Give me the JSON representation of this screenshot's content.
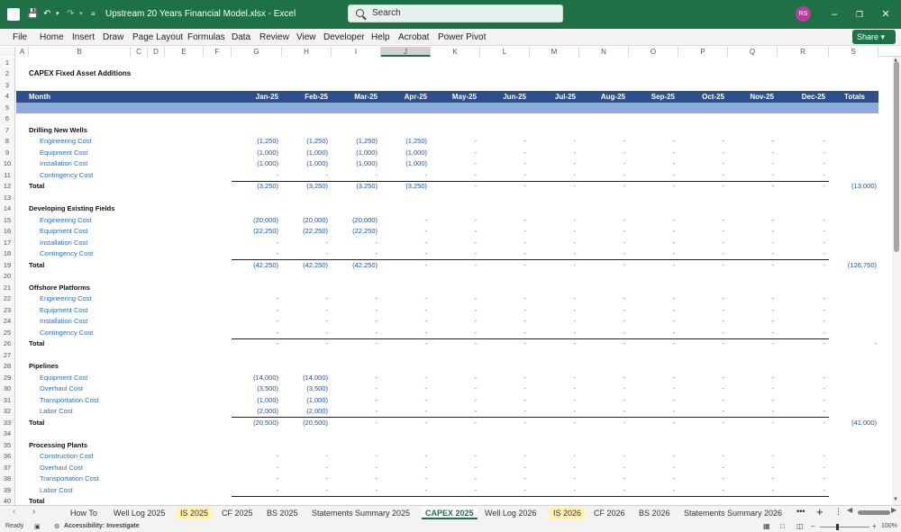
{
  "window": {
    "title": "Upstream 20 Years Financial Model.xlsx - Excel",
    "search_placeholder": "Search",
    "user_initials": "RS"
  },
  "ribbon_tabs": [
    "File",
    "Home",
    "Insert",
    "Draw",
    "Page Layout",
    "Formulas",
    "Data",
    "Review",
    "View",
    "Developer",
    "Help",
    "Acrobat",
    "Power Pivot"
  ],
  "share_label": "Share",
  "columns": [
    "A",
    "B",
    "C",
    "D",
    "E",
    "F",
    "G",
    "H",
    "I",
    "J",
    "K",
    "L",
    "M",
    "N",
    "O",
    "P",
    "Q",
    "R",
    "S"
  ],
  "selected_column": "J",
  "rows": [
    "1",
    "2",
    "3",
    "4",
    "5",
    "6",
    "7",
    "8",
    "9",
    "10",
    "11",
    "12",
    "13",
    "14",
    "15",
    "16",
    "17",
    "18",
    "19",
    "20",
    "21",
    "22",
    "23",
    "24",
    "25",
    "26",
    "27",
    "28",
    "29",
    "30",
    "31",
    "32",
    "33",
    "34",
    "35",
    "36",
    "37",
    "38",
    "39",
    "40"
  ],
  "sheet_title": "CAPEX Fixed Asset Additions",
  "header": {
    "label": "Month",
    "months": [
      "Jan-25",
      "Feb-25",
      "Mar-25",
      "Apr-25",
      "May-25",
      "Jun-25",
      "Jul-25",
      "Aug-25",
      "Sep-25",
      "Oct-25",
      "Nov-25",
      "Dec-25"
    ],
    "totals_label": "Totals"
  },
  "sections": [
    {
      "title": "Drilling New Wells",
      "title_row": 6,
      "items": [
        {
          "row": 7,
          "label": "Engineering Cost",
          "values": [
            "(1,250)",
            "(1,250)",
            "(1,250)",
            "(1,250)",
            "-",
            "-",
            "-",
            "-",
            "-",
            "-",
            "-",
            "-"
          ]
        },
        {
          "row": 8,
          "label": "Equipment Cost",
          "values": [
            "(1,000)",
            "(1,000)",
            "(1,000)",
            "(1,000)",
            "-",
            "-",
            "-",
            "-",
            "-",
            "-",
            "-",
            "-"
          ]
        },
        {
          "row": 9,
          "label": "Installation Cost",
          "values": [
            "(1,000)",
            "(1,000)",
            "(1,000)",
            "(1,000)",
            "-",
            "-",
            "-",
            "-",
            "-",
            "-",
            "-",
            "-"
          ]
        },
        {
          "row": 10,
          "label": "Contingency Cost",
          "values": [
            "-",
            "-",
            "-",
            "-",
            "-",
            "-",
            "-",
            "-",
            "-",
            "-",
            "-",
            "-"
          ]
        }
      ],
      "total": {
        "row": 11,
        "label": "Total",
        "values": [
          "(3,250)",
          "(3,250)",
          "(3,250)",
          "(3,250)",
          "-",
          "-",
          "-",
          "-",
          "-",
          "-",
          "-",
          "-"
        ],
        "sum": "(13,000)"
      }
    },
    {
      "title": "Developing Existing Fields",
      "title_row": 13,
      "items": [
        {
          "row": 14,
          "label": "Engineering Cost",
          "values": [
            "(20,000)",
            "(20,000)",
            "(20,000)",
            "-",
            "-",
            "-",
            "-",
            "-",
            "-",
            "-",
            "-",
            "-"
          ]
        },
        {
          "row": 15,
          "label": "Equipment Cost",
          "values": [
            "(22,250)",
            "(22,250)",
            "(22,250)",
            "-",
            "-",
            "-",
            "-",
            "-",
            "-",
            "-",
            "-",
            "-"
          ]
        },
        {
          "row": 16,
          "label": "Installation Cost",
          "values": [
            "-",
            "-",
            "-",
            "-",
            "-",
            "-",
            "-",
            "-",
            "-",
            "-",
            "-",
            "-"
          ]
        },
        {
          "row": 17,
          "label": "Contingency Cost",
          "values": [
            "-",
            "-",
            "-",
            "-",
            "-",
            "-",
            "-",
            "-",
            "-",
            "-",
            "-",
            "-"
          ]
        }
      ],
      "total": {
        "row": 18,
        "label": "Total",
        "values": [
          "(42,250)",
          "(42,250)",
          "(42,250)",
          "-",
          "-",
          "-",
          "-",
          "-",
          "-",
          "-",
          "-",
          "-"
        ],
        "sum": "(126,750)"
      }
    },
    {
      "title": "Offshore Platforms",
      "title_row": 20,
      "items": [
        {
          "row": 21,
          "label": "Engineering Cost",
          "values": [
            "-",
            "-",
            "-",
            "-",
            "-",
            "-",
            "-",
            "-",
            "-",
            "-",
            "-",
            "-"
          ]
        },
        {
          "row": 22,
          "label": "Equipment Cost",
          "values": [
            "-",
            "-",
            "-",
            "-",
            "-",
            "-",
            "-",
            "-",
            "-",
            "-",
            "-",
            "-"
          ]
        },
        {
          "row": 23,
          "label": "Installation Cost",
          "values": [
            "-",
            "-",
            "-",
            "-",
            "-",
            "-",
            "-",
            "-",
            "-",
            "-",
            "-",
            "-"
          ]
        },
        {
          "row": 24,
          "label": "Contingency Cost",
          "values": [
            "-",
            "-",
            "-",
            "-",
            "-",
            "-",
            "-",
            "-",
            "-",
            "-",
            "-",
            "-"
          ]
        }
      ],
      "total": {
        "row": 25,
        "label": "Total",
        "values": [
          "-",
          "-",
          "-",
          "-",
          "-",
          "-",
          "-",
          "-",
          "-",
          "-",
          "-",
          "-"
        ],
        "sum": "-"
      }
    },
    {
      "title": "Pipelines",
      "title_row": 27,
      "items": [
        {
          "row": 28,
          "label": "Equipment Cost",
          "values": [
            "(14,000)",
            "(14,000)",
            "-",
            "-",
            "-",
            "-",
            "-",
            "-",
            "-",
            "-",
            "-",
            "-"
          ]
        },
        {
          "row": 29,
          "label": "Overhaul Cost",
          "values": [
            "(3,500)",
            "(3,500)",
            "-",
            "-",
            "-",
            "-",
            "-",
            "-",
            "-",
            "-",
            "-",
            "-"
          ]
        },
        {
          "row": 30,
          "label": "Transportation Cost",
          "values": [
            "(1,000)",
            "(1,000)",
            "-",
            "-",
            "-",
            "-",
            "-",
            "-",
            "-",
            "-",
            "-",
            "-"
          ]
        },
        {
          "row": 31,
          "label": "Labor Cost",
          "values": [
            "(2,000)",
            "(2,000)",
            "-",
            "-",
            "-",
            "-",
            "-",
            "-",
            "-",
            "-",
            "-",
            "-"
          ]
        }
      ],
      "total": {
        "row": 32,
        "label": "Total",
        "values": [
          "(20,500)",
          "(20,500)",
          "-",
          "-",
          "-",
          "-",
          "-",
          "-",
          "-",
          "-",
          "-",
          "-"
        ],
        "sum": "(41,000)"
      }
    },
    {
      "title": "Processing Plants",
      "title_row": 34,
      "items": [
        {
          "row": 35,
          "label": "Construction Cost",
          "values": [
            "-",
            "-",
            "-",
            "-",
            "-",
            "-",
            "-",
            "-",
            "-",
            "-",
            "-",
            "-"
          ]
        },
        {
          "row": 36,
          "label": "Overhaul Cost",
          "values": [
            "-",
            "-",
            "-",
            "-",
            "-",
            "-",
            "-",
            "-",
            "-",
            "-",
            "-",
            "-"
          ]
        },
        {
          "row": 37,
          "label": "Transportation Cost",
          "values": [
            "-",
            "-",
            "-",
            "-",
            "-",
            "-",
            "-",
            "-",
            "-",
            "-",
            "-",
            "-"
          ]
        },
        {
          "row": 38,
          "label": "Labor Cost",
          "values": [
            "-",
            "-",
            "-",
            "-",
            "-",
            "-",
            "-",
            "-",
            "-",
            "-",
            "-",
            "-"
          ]
        }
      ],
      "total": {
        "row": 39,
        "label": "Total",
        "values": [],
        "sum": ""
      }
    }
  ],
  "sheet_tabs": [
    {
      "label": "How To",
      "style": "normal"
    },
    {
      "label": "Well Log 2025",
      "style": "normal"
    },
    {
      "label": "IS 2025",
      "style": "highlight"
    },
    {
      "label": "CF 2025",
      "style": "normal"
    },
    {
      "label": "BS 2025",
      "style": "normal"
    },
    {
      "label": "Statements Summary 2025",
      "style": "normal"
    },
    {
      "label": "CAPEX 2025",
      "style": "active"
    },
    {
      "label": "Well Log 2026",
      "style": "normal"
    },
    {
      "label": "IS 2026",
      "style": "highlight"
    },
    {
      "label": "CF 2026",
      "style": "normal"
    },
    {
      "label": "BS 2026",
      "style": "normal"
    },
    {
      "label": "Statements Summary 2026",
      "style": "normal"
    }
  ],
  "status": {
    "ready": "Ready",
    "accessibility": "Accessibility: Investigate",
    "zoom": "100%"
  }
}
